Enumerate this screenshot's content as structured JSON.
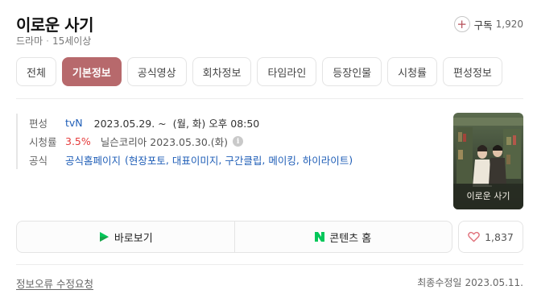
{
  "header": {
    "title": "이로운 사기",
    "genre": "드라마",
    "rating_age": "15세이상",
    "subscribe_label": "구독",
    "subscribe_count": "1,920"
  },
  "tabs": [
    {
      "label": "전체",
      "active": false
    },
    {
      "label": "기본정보",
      "active": true
    },
    {
      "label": "공식영상",
      "active": false
    },
    {
      "label": "회차정보",
      "active": false
    },
    {
      "label": "타임라인",
      "active": false
    },
    {
      "label": "등장인물",
      "active": false
    },
    {
      "label": "시청률",
      "active": false
    },
    {
      "label": "편성정보",
      "active": false
    }
  ],
  "info": {
    "schedule_label": "편성",
    "channel": "tvN",
    "schedule": "2023.05.29. ~  (월, 화) 오후 08:50",
    "viewership_label": "시청률",
    "viewership_value": "3.5%",
    "viewership_source": "닐슨코리아 2023.05.30.(화)",
    "official_label": "공식",
    "official_homepage": "공식홈페이지",
    "official_links": [
      "현장포토",
      "대표이미지",
      "구간클립",
      "메이킹",
      "하이라이트"
    ]
  },
  "poster": {
    "text": "이로운 사기"
  },
  "actions": {
    "watch_label": "바로보기",
    "content_home_label": "콘텐츠 홈",
    "like_count": "1,837"
  },
  "footer": {
    "report_label": "정보오류 수정요청",
    "updated_label": "최종수정일",
    "updated_date": "2023.05.11."
  },
  "colors": {
    "accent": "#b7696c",
    "link": "#1f5eb7",
    "rating": "#e53b3b",
    "naver_green": "#03c75a"
  }
}
